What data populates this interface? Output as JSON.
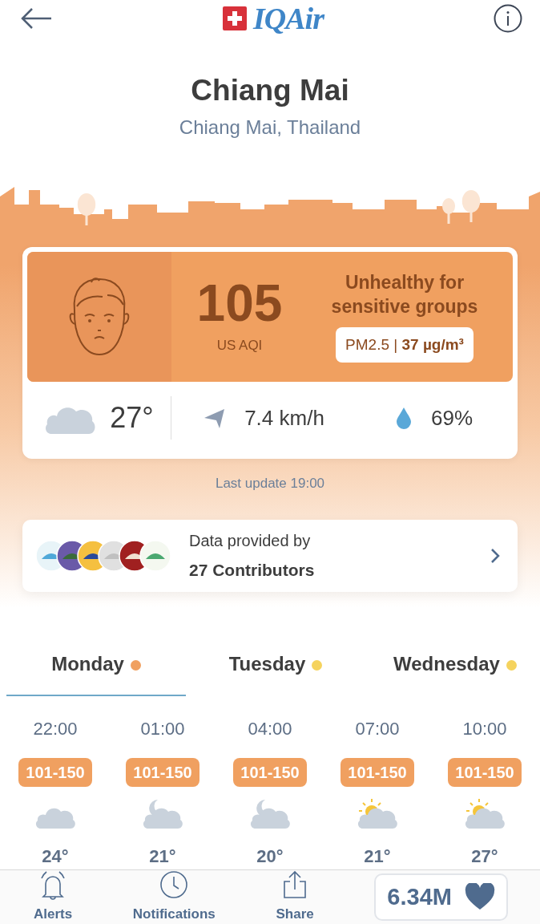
{
  "header": {
    "logo_text": "IQAir"
  },
  "location": {
    "city": "Chiang Mai",
    "region": "Chiang Mai, Thailand"
  },
  "aqi": {
    "value": "105",
    "unit": "US AQI",
    "status": "Unhealthy for sensitive groups",
    "pollutant": "PM2.5 | **37 µg/m³**"
  },
  "weather": {
    "temperature": "27°",
    "wind": "7.4 km/h",
    "humidity": "69%"
  },
  "last_update": "Last update 19:00",
  "contributors": {
    "label": "Data provided by",
    "count": "27 Contributors"
  },
  "day_tabs": [
    {
      "label": "Monday",
      "color": "#f0a060",
      "selected": true
    },
    {
      "label": "Tuesday",
      "color": "#f5d35e",
      "selected": false
    },
    {
      "label": "Wednesday",
      "color": "#f5d35e",
      "selected": false
    }
  ],
  "hourly": [
    {
      "time": "22:00",
      "aqi_range": "101-150",
      "kind": "cloud",
      "temperature": "24°"
    },
    {
      "time": "01:00",
      "aqi_range": "101-150",
      "kind": "moon",
      "temperature": "21°"
    },
    {
      "time": "04:00",
      "aqi_range": "101-150",
      "kind": "moon",
      "temperature": "20°"
    },
    {
      "time": "07:00",
      "aqi_range": "101-150",
      "kind": "sun",
      "temperature": "21°"
    },
    {
      "time": "10:00",
      "aqi_range": "101-150",
      "kind": "sun",
      "temperature": "27°"
    }
  ],
  "bottom_bar": [
    {
      "kind": "alerts",
      "label": "Alerts"
    },
    {
      "kind": "notifications",
      "label": "Notifications"
    },
    {
      "kind": "share",
      "label": "Share"
    },
    {
      "kind": "likes",
      "label": "6.34M"
    }
  ]
}
